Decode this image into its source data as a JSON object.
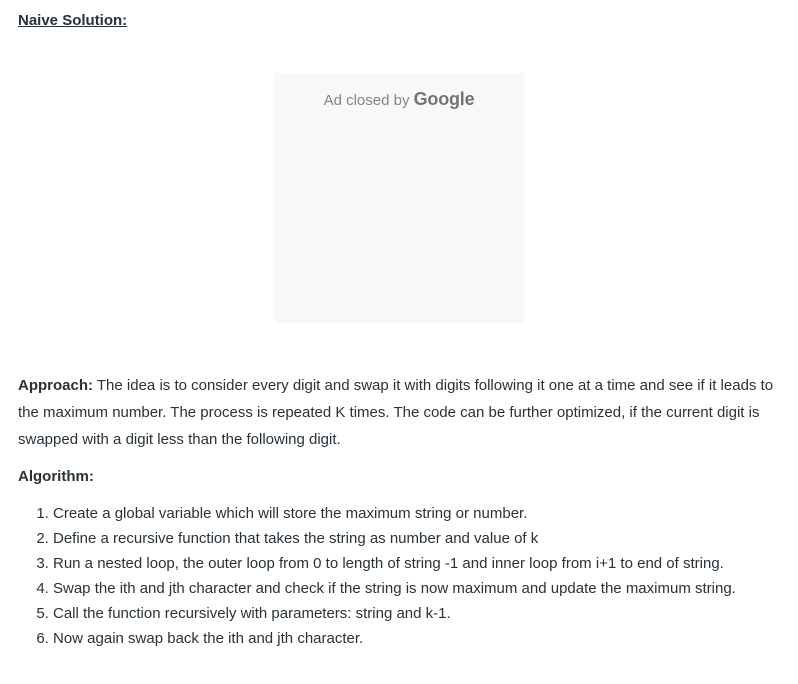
{
  "heading": "Naive Solution:",
  "ad": {
    "text": "Ad closed by",
    "brand": "Google"
  },
  "approach": {
    "label": "Approach:",
    "text": " The idea is to consider every digit and swap it with digits following it one at a time and see if it leads to the maximum number. The process is repeated K times. The code can be further optimized, if the current digit is swapped with a digit less than the following digit."
  },
  "algorithm": {
    "heading": "Algorithm:",
    "steps": [
      "Create a global variable which will store the maximum string or number.",
      "Define a recursive function that takes the string as number and value of k",
      "Run a nested loop, the outer loop from 0 to length of string -1 and inner loop from i+1 to end of string.",
      "Swap the ith and jth character and check if the string is now maximum and update the maximum string.",
      "Call the function recursively with parameters: string and k-1.",
      "Now again swap back the ith and jth character."
    ]
  }
}
